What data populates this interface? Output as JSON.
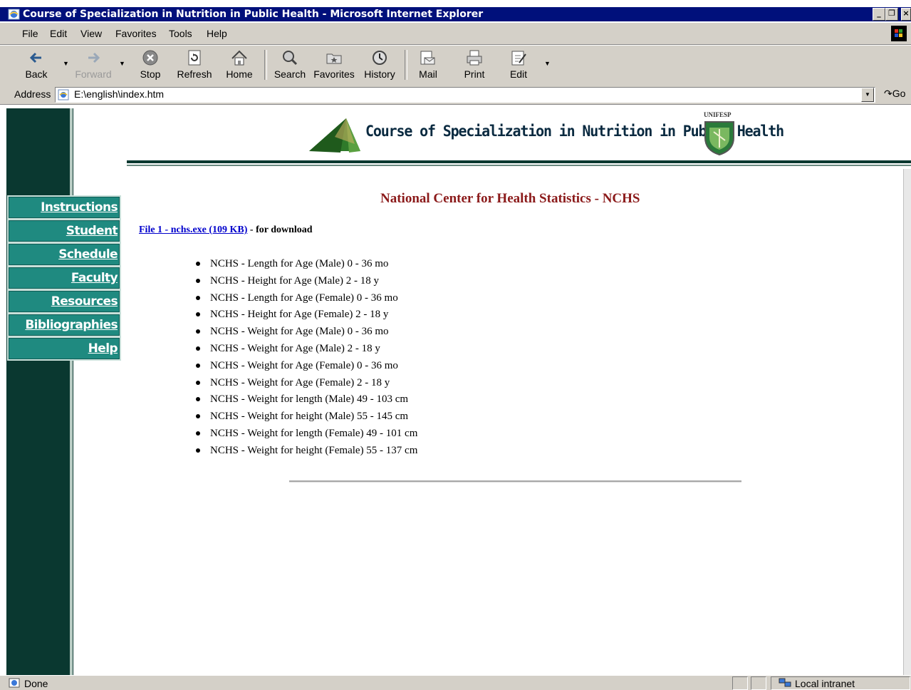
{
  "window": {
    "title": "Course of Specialization in Nutrition in Public Health - Microsoft Internet Explorer"
  },
  "menu": [
    "File",
    "Edit",
    "View",
    "Favorites",
    "Tools",
    "Help"
  ],
  "toolbar": {
    "back": "Back",
    "forward": "Forward",
    "stop": "Stop",
    "refresh": "Refresh",
    "home": "Home",
    "search": "Search",
    "favorites": "Favorites",
    "history": "History",
    "mail": "Mail",
    "print": "Print",
    "edit": "Edit"
  },
  "address": {
    "label": "Address",
    "url": "E:\\english\\index.htm",
    "go": "Go"
  },
  "banner": {
    "title": "Course of Specialization in Nutrition in Public Health",
    "seal_text": "UNIFESP"
  },
  "nav": [
    "Instructions",
    "Student",
    "Schedule",
    "Faculty",
    "Resources",
    "Bibliographies",
    "Help"
  ],
  "page": {
    "heading": "National Center for Health Statistics - NCHS",
    "download_link": "File 1 - nchs.exe (109 KB)",
    "download_suffix": " - for download",
    "items": [
      "NCHS - Length for Age (Male)  0 - 36 mo",
      "NCHS - Height for Age (Male)  2 - 18 y",
      "NCHS - Length for Age (Female)  0 - 36 mo",
      "NCHS - Height for Age (Female)  2 - 18 y",
      "NCHS - Weight for Age (Male)  0 - 36 mo",
      "NCHS - Weight for Age (Male)  2 - 18 y",
      "NCHS - Weight for Age (Female)  0 - 36 mo",
      "NCHS - Weight for Age (Female)  2 - 18 y",
      "NCHS - Weight for length (Male)  49 - 103 cm",
      "NCHS - Weight for height (Male)  55 - 145 cm",
      "NCHS - Weight for length (Female)  49 - 101 cm",
      "NCHS - Weight for height (Female)  55 - 137 cm"
    ]
  },
  "status": {
    "text": "Done",
    "zone": "Local intranet"
  },
  "colors": {
    "titlebar": "#00107b",
    "sidebar": "#0a3830",
    "nav_button": "#1f8a80",
    "heading": "#8b1a1a",
    "link": "#0000cc"
  }
}
